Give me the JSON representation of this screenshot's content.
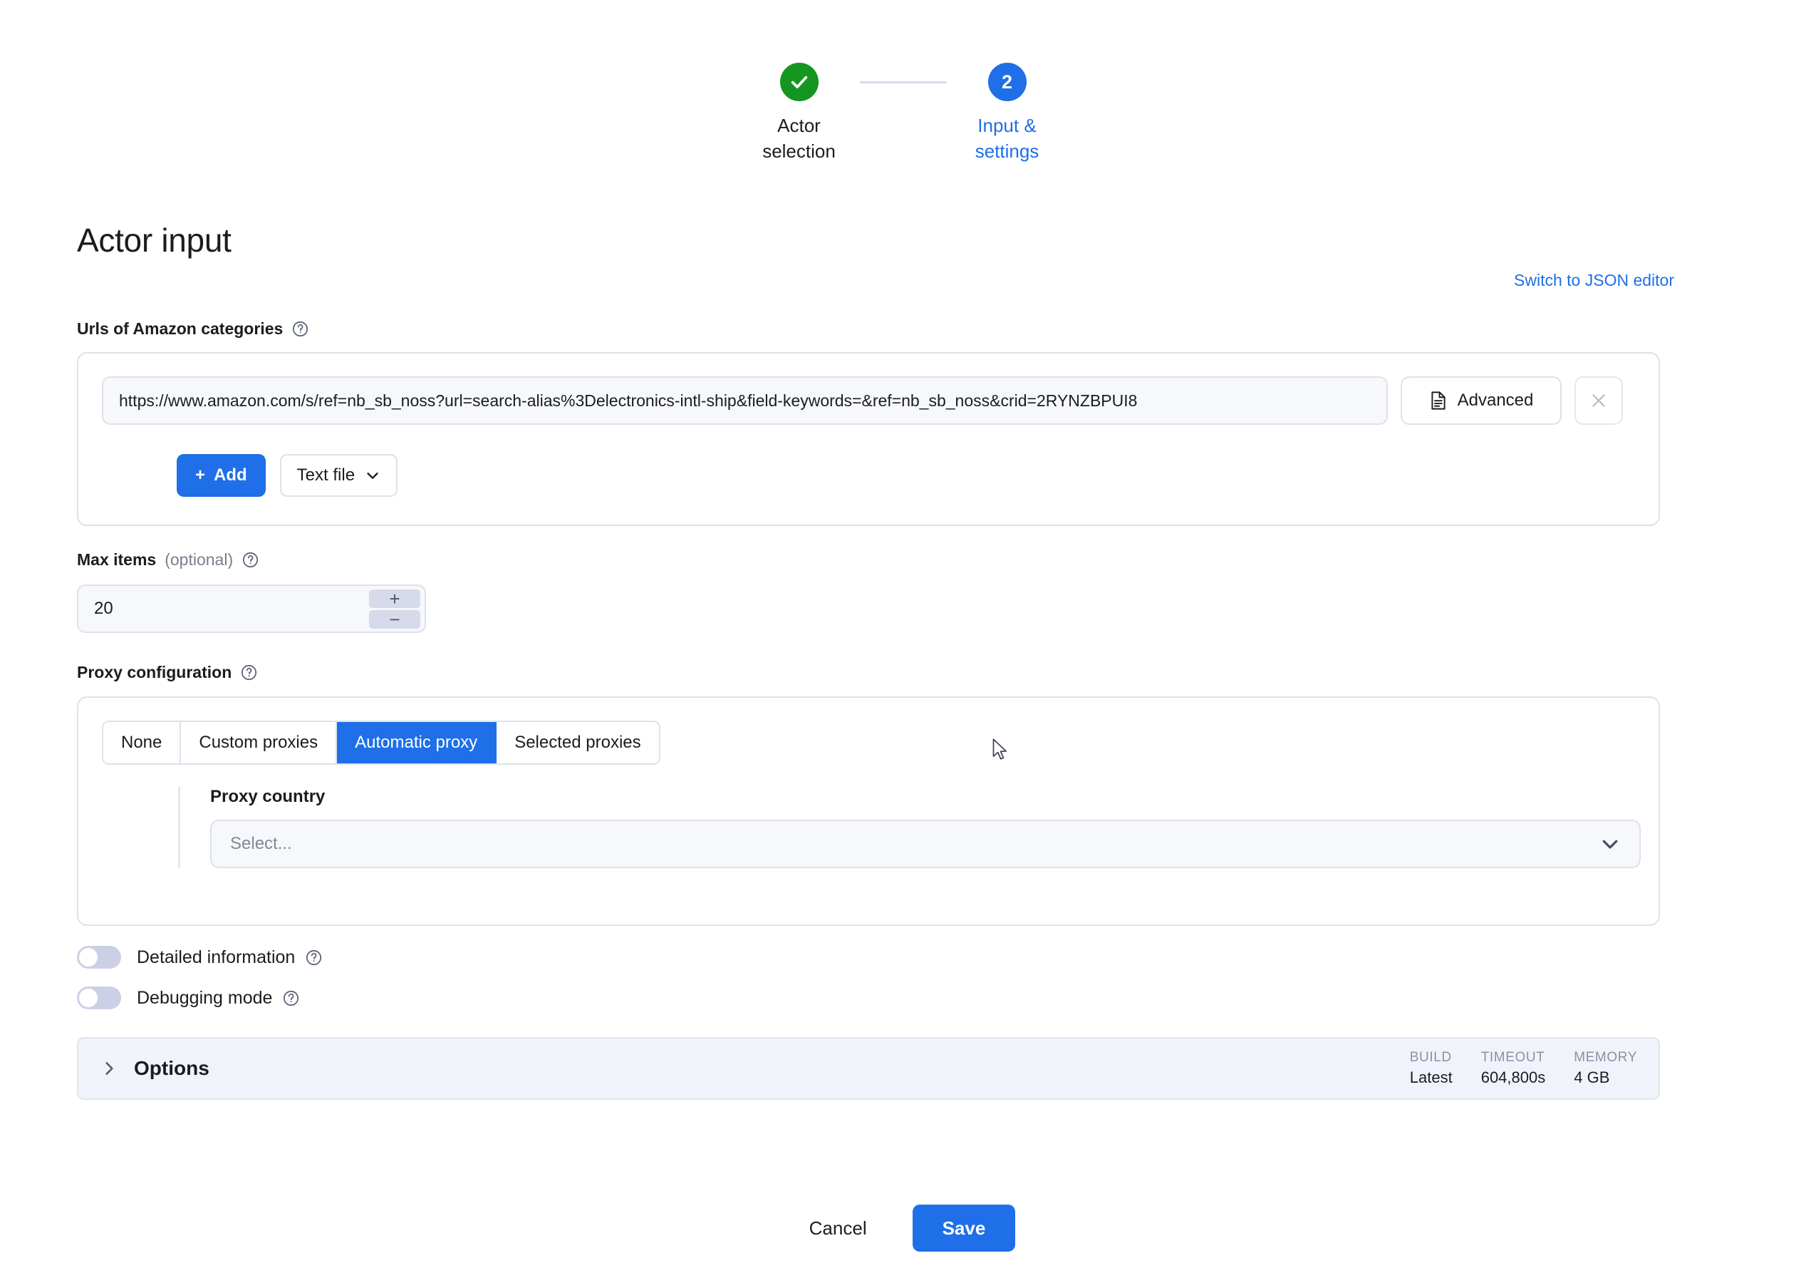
{
  "stepper": {
    "steps": [
      {
        "id": "actor-selection",
        "badge": "check-icon",
        "label": "Actor\nselection",
        "label_line1": "Actor",
        "label_line2": "selection",
        "state": "done",
        "color": "#149620"
      },
      {
        "id": "input-settings",
        "badge": "2",
        "label_line1": "Input &",
        "label_line2": "settings",
        "state": "current",
        "color": "#1e6fe8"
      }
    ]
  },
  "page": {
    "title": "Actor input",
    "json_editor_link": "Switch to JSON editor"
  },
  "urls_field": {
    "label": "Urls of Amazon categories",
    "help": "?",
    "url_value": "https://www.amazon.com/s/ref=nb_sb_noss?url=search-alias%3Delectronics-intl-ship&field-keywords=&ref=nb_sb_noss&crid=2RYNZBPUI8",
    "advanced_label": "Advanced",
    "clear_label": "×",
    "add_label": "Add",
    "add_plus": "+",
    "source_type": "Text file"
  },
  "max_items": {
    "label": "Max items",
    "optional": "(optional)",
    "help": "?",
    "value": "20",
    "increment": "+",
    "decrement": "−"
  },
  "proxy": {
    "label": "Proxy configuration",
    "help": "?",
    "tabs": [
      {
        "label": "None",
        "active": false
      },
      {
        "label": "Custom proxies",
        "active": false
      },
      {
        "label": "Automatic proxy",
        "active": true
      },
      {
        "label": "Selected proxies",
        "active": false
      }
    ],
    "country_label": "Proxy country",
    "country_placeholder": "Select..."
  },
  "toggles": [
    {
      "label": "Detailed information",
      "help": "?",
      "on": false
    },
    {
      "label": "Debugging mode",
      "help": "?",
      "on": false
    }
  ],
  "options": {
    "title": "Options",
    "expanded": false,
    "meta": [
      {
        "key": "BUILD",
        "value": "Latest"
      },
      {
        "key": "TIMEOUT",
        "value": "604,800s"
      },
      {
        "key": "MEMORY",
        "value": "4 GB"
      }
    ]
  },
  "footer": {
    "cancel_label": "Cancel",
    "save_label": "Save"
  },
  "colors": {
    "accent": "#1e6fe8",
    "success": "#149620",
    "field_bg": "#f7f8fc",
    "border": "#dfe1ea"
  }
}
